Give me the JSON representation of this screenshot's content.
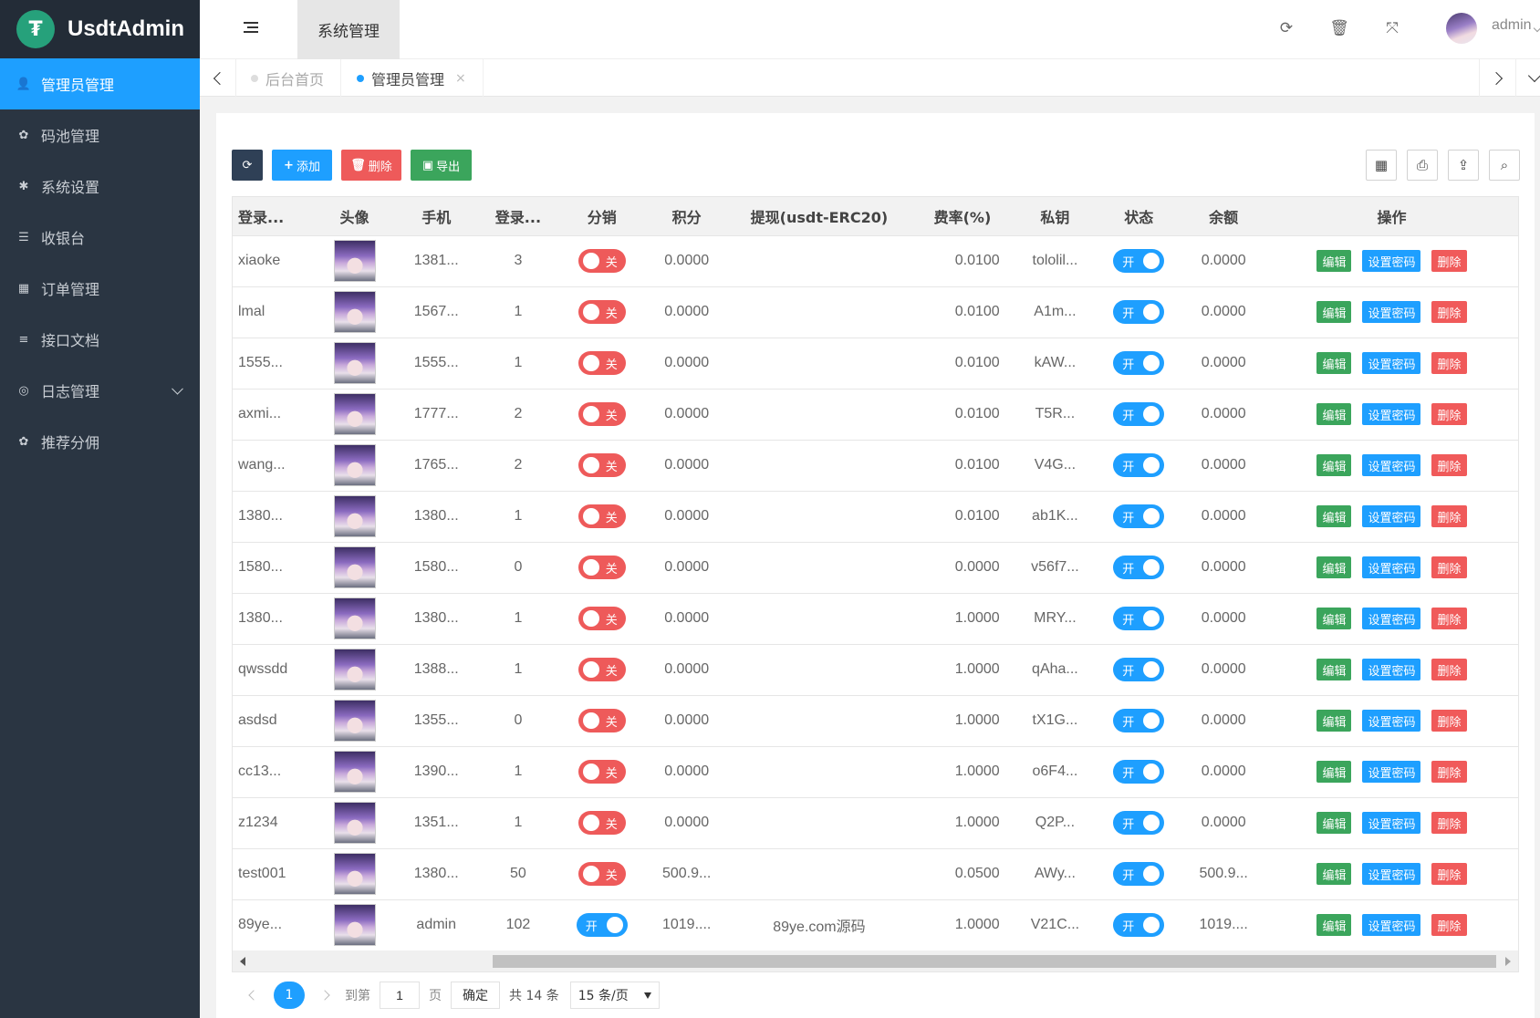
{
  "app": {
    "title": "UsdtAdmin",
    "logo_char": "₮"
  },
  "sidebar": {
    "items": [
      {
        "label": "管理员管理",
        "icon": "user-icon",
        "glyph": "👤",
        "active": true
      },
      {
        "label": "码池管理",
        "icon": "android-icon",
        "glyph": "✿"
      },
      {
        "label": "系统设置",
        "icon": "gear-icon",
        "glyph": "✱"
      },
      {
        "label": "收银台",
        "icon": "list-icon",
        "glyph": "☰"
      },
      {
        "label": "订单管理",
        "icon": "calculator-icon",
        "glyph": "▦"
      },
      {
        "label": "接口文档",
        "icon": "align-icon",
        "glyph": "≡"
      },
      {
        "label": "日志管理",
        "icon": "chrome-icon",
        "glyph": "◎",
        "has_children": true
      },
      {
        "label": "推荐分佣",
        "icon": "android-icon",
        "glyph": "✿"
      }
    ]
  },
  "header": {
    "module_tab": "系统管理",
    "user": "admin"
  },
  "tabs": {
    "home": "后台首页",
    "current": "管理员管理",
    "close": "×"
  },
  "toolbar": {
    "add": "添加",
    "delete": "删除",
    "export": "导出"
  },
  "table": {
    "columns": [
      "登录...",
      "头像",
      "手机",
      "登录...",
      "分销",
      "积分",
      "提现(usdt-ERC20)",
      "费率(%)",
      "私钥",
      "状态",
      "余额",
      "操作"
    ],
    "on_label": "开",
    "off_label": "关",
    "ops": {
      "edit": "编辑",
      "set_pwd": "设置密码",
      "delete": "删除"
    },
    "rows": [
      {
        "login": "xiaoke",
        "phone": "1381...",
        "count": "3",
        "dist": false,
        "points": "0.0000",
        "withdraw": "",
        "rate": "0.0100",
        "key": "tololil...",
        "status": true,
        "balance": "0.0000"
      },
      {
        "login": "lmal",
        "phone": "1567...",
        "count": "1",
        "dist": false,
        "points": "0.0000",
        "withdraw": "",
        "rate": "0.0100",
        "key": "A1m...",
        "status": true,
        "balance": "0.0000"
      },
      {
        "login": "1555...",
        "phone": "1555...",
        "count": "1",
        "dist": false,
        "points": "0.0000",
        "withdraw": "",
        "rate": "0.0100",
        "key": "kAW...",
        "status": true,
        "balance": "0.0000"
      },
      {
        "login": "axmi...",
        "phone": "1777...",
        "count": "2",
        "dist": false,
        "points": "0.0000",
        "withdraw": "",
        "rate": "0.0100",
        "key": "T5R...",
        "status": true,
        "balance": "0.0000"
      },
      {
        "login": "wang...",
        "phone": "1765...",
        "count": "2",
        "dist": false,
        "points": "0.0000",
        "withdraw": "",
        "rate": "0.0100",
        "key": "V4G...",
        "status": true,
        "balance": "0.0000"
      },
      {
        "login": "1380...",
        "phone": "1380...",
        "count": "1",
        "dist": false,
        "points": "0.0000",
        "withdraw": "",
        "rate": "0.0100",
        "key": "ab1K...",
        "status": true,
        "balance": "0.0000"
      },
      {
        "login": "1580...",
        "phone": "1580...",
        "count": "0",
        "dist": false,
        "points": "0.0000",
        "withdraw": "",
        "rate": "0.0000",
        "key": "v56f7...",
        "status": true,
        "balance": "0.0000"
      },
      {
        "login": "1380...",
        "phone": "1380...",
        "count": "1",
        "dist": false,
        "points": "0.0000",
        "withdraw": "",
        "rate": "1.0000",
        "key": "MRY...",
        "status": true,
        "balance": "0.0000"
      },
      {
        "login": "qwssdd",
        "phone": "1388...",
        "count": "1",
        "dist": false,
        "points": "0.0000",
        "withdraw": "",
        "rate": "1.0000",
        "key": "qAha...",
        "status": true,
        "balance": "0.0000"
      },
      {
        "login": "asdsd",
        "phone": "1355...",
        "count": "0",
        "dist": false,
        "points": "0.0000",
        "withdraw": "",
        "rate": "1.0000",
        "key": "tX1G...",
        "status": true,
        "balance": "0.0000"
      },
      {
        "login": "cc13...",
        "phone": "1390...",
        "count": "1",
        "dist": false,
        "points": "0.0000",
        "withdraw": "",
        "rate": "1.0000",
        "key": "o6F4...",
        "status": true,
        "balance": "0.0000"
      },
      {
        "login": "z1234",
        "phone": "1351...",
        "count": "1",
        "dist": false,
        "points": "0.0000",
        "withdraw": "",
        "rate": "1.0000",
        "key": "Q2P...",
        "status": true,
        "balance": "0.0000"
      },
      {
        "login": "test001",
        "phone": "1380...",
        "count": "50",
        "dist": false,
        "points": "500.9...",
        "withdraw": "",
        "rate": "0.0500",
        "key": "AWy...",
        "status": true,
        "balance": "500.9..."
      },
      {
        "login": "89ye...",
        "phone": "admin",
        "count": "102",
        "dist": true,
        "points": "1019....",
        "withdraw": "89ye.com源码",
        "rate": "1.0000",
        "key": "V21C...",
        "status": true,
        "balance": "1019...."
      }
    ]
  },
  "pager": {
    "current": "1",
    "goto_label": "到第",
    "page_value": "1",
    "page_label": "页",
    "confirm": "确定",
    "total": "共 14 条",
    "page_size": "15 条/页"
  },
  "colors": {
    "accent": "#1e9fff",
    "sidebar": "#2a3542",
    "danger": "#ee5a5a",
    "success": "#3ba55c"
  }
}
